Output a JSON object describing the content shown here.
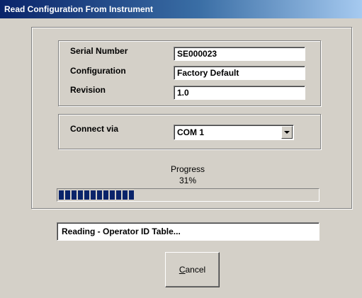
{
  "window": {
    "title": "Read Configuration From Instrument"
  },
  "info": {
    "serial_label": "Serial Number",
    "serial_value": "SE000023",
    "config_label": "Configuration",
    "config_value": "Factory Default",
    "revision_label": "Revision",
    "revision_value": "1.0"
  },
  "connect": {
    "label": "Connect via",
    "selected": "COM 1"
  },
  "progress": {
    "label": "Progress",
    "percent_text": "31%",
    "fraction": 0.31
  },
  "status": {
    "text": "Reading - Operator ID Table..."
  },
  "buttons": {
    "cancel_mnemonic": "C",
    "cancel_rest": "ancel"
  },
  "colors": {
    "progress_fill": "#0a246a",
    "title_bar": "#0a246a",
    "dialog_bg": "#d4d0c8"
  }
}
